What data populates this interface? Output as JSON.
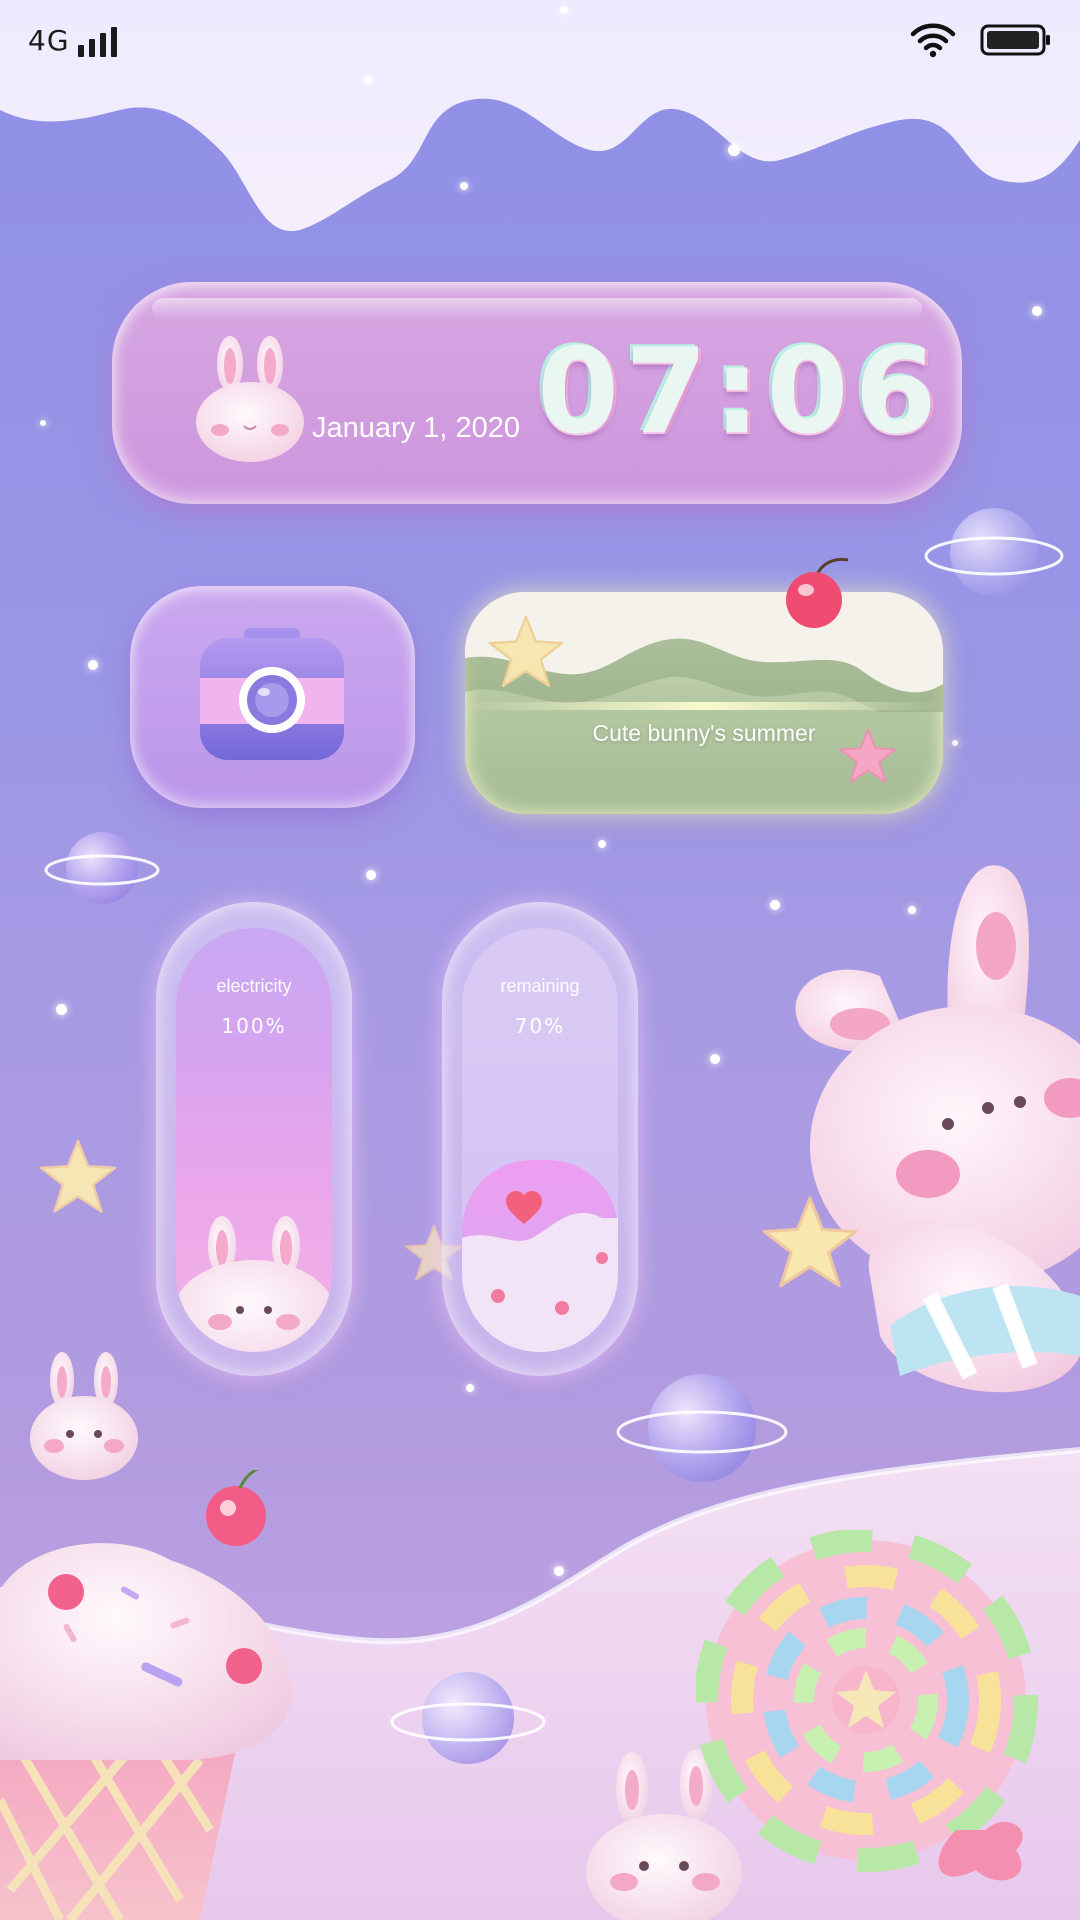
{
  "status_bar": {
    "network_type": "4G",
    "signal_level": 4,
    "wifi": true,
    "battery_level": 1.0
  },
  "time_widget": {
    "date": "January 1, 2020",
    "time": "07:06"
  },
  "camera_widget": {
    "icon": "camera-icon"
  },
  "banner_widget": {
    "title": "Cute bunny's summer"
  },
  "electricity_widget": {
    "label": "electricity",
    "value": "100%",
    "fill_fraction": 1.0
  },
  "remaining_widget": {
    "label": "remaining",
    "value": "70%",
    "fill_fraction": 0.7
  },
  "colors": {
    "background_top": "#8e8fe6",
    "background_bottom": "#c7a8e6",
    "widget_pink": "#d896dc",
    "banner_green": "#a5bc95",
    "text": "#ffffff"
  }
}
